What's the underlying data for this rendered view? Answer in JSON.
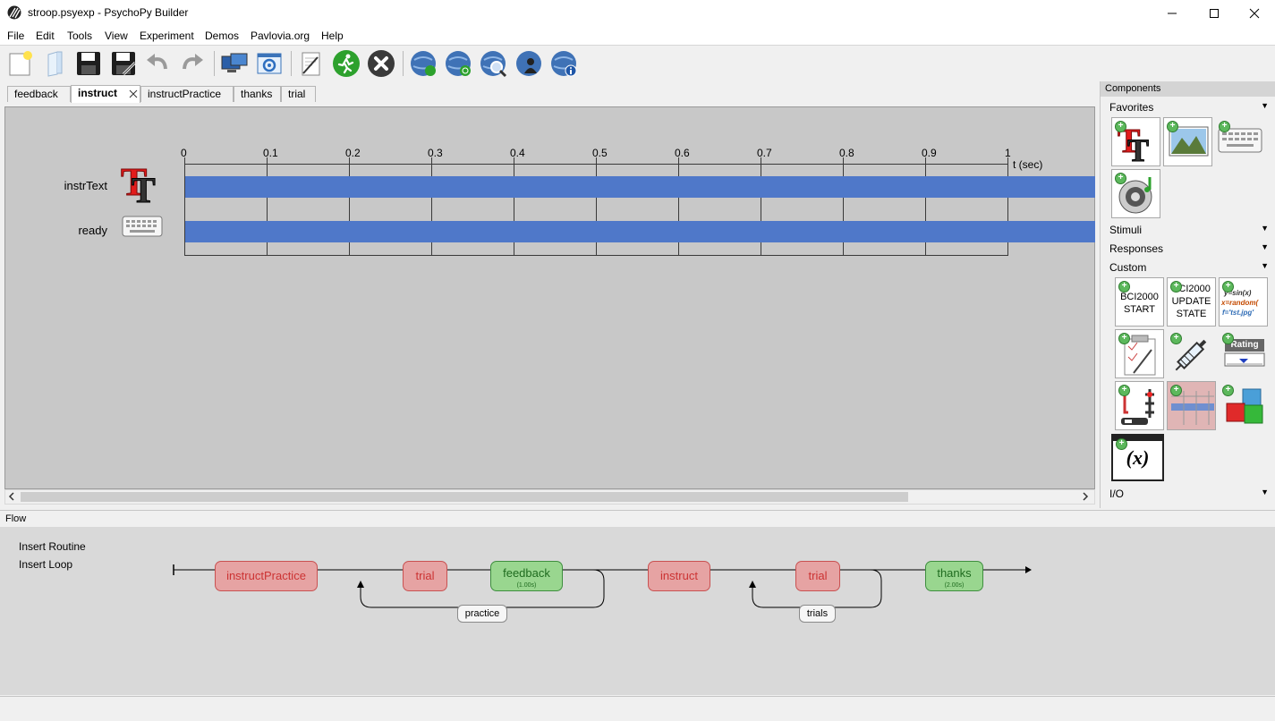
{
  "window": {
    "title": "stroop.psyexp - PsychoPy Builder",
    "minimize": "—",
    "maximize": "☐",
    "close": "✕"
  },
  "menu": [
    "File",
    "Edit",
    "Tools",
    "View",
    "Experiment",
    "Demos",
    "Pavlovia.org",
    "Help"
  ],
  "toolbar_icons": [
    "new-file-icon",
    "open-file-icon",
    "save-icon",
    "save-as-icon",
    "undo-icon",
    "redo-icon",
    "monitor-center-icon",
    "experiment-settings-icon",
    "compile-script-icon",
    "run-icon",
    "stop-icon",
    "pavlovia-sync-icon",
    "pavlovia-sync-refresh-icon",
    "pavlovia-search-icon",
    "pavlovia-user-icon",
    "pavlovia-info-icon"
  ],
  "tabs": [
    {
      "label": "feedback",
      "active": false
    },
    {
      "label": "instruct",
      "active": true
    },
    {
      "label": "instructPractice",
      "active": false
    },
    {
      "label": "thanks",
      "active": false
    },
    {
      "label": "trial",
      "active": false
    }
  ],
  "routine": {
    "ticks": [
      "0",
      "0.1",
      "0.2",
      "0.3",
      "0.4",
      "0.5",
      "0.6",
      "0.7",
      "0.8",
      "0.9",
      "1"
    ],
    "time_unit": "t (sec)",
    "components": [
      {
        "name": "instrText",
        "icon": "text-component-icon"
      },
      {
        "name": "ready",
        "icon": "keyboard-component-icon"
      }
    ]
  },
  "components_panel": {
    "header": "Components",
    "categories": {
      "favorites": "Favorites",
      "stimuli": "Stimuli",
      "responses": "Responses",
      "custom": "Custom",
      "io": "I/O"
    },
    "custom_labels": {
      "bci_start": "BCI2000\nSTART",
      "bci_update": "BCI2000\nUPDATE\nSTATE",
      "code1": "y=sin(x)",
      "code2": "x=random(",
      "code3": "f='tst.jpg'",
      "rating": "Rating",
      "variable": "(x)"
    }
  },
  "flow": {
    "label": "Flow",
    "insert_routine": "Insert Routine",
    "insert_loop": "Insert Loop",
    "routines": [
      {
        "name": "instructPractice",
        "color": "red"
      },
      {
        "name": "trial",
        "color": "red"
      },
      {
        "name": "feedback",
        "color": "green",
        "duration": "(1.00s)"
      },
      {
        "name": "instruct",
        "color": "red"
      },
      {
        "name": "trial",
        "color": "red"
      },
      {
        "name": "thanks",
        "color": "green",
        "duration": "(2.00s)"
      }
    ],
    "loops": [
      "practice",
      "trials"
    ]
  }
}
